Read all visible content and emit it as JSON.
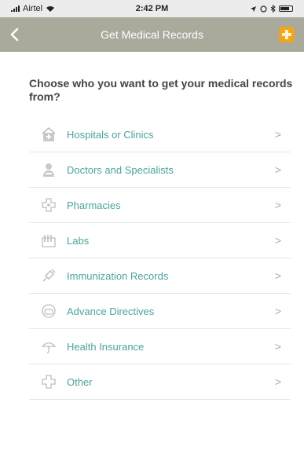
{
  "status_bar": {
    "carrier": "Airtel",
    "time": "2:42 PM"
  },
  "nav": {
    "title": "Get Medical Records",
    "back_icon": "chevron-left-icon",
    "badge_icon": "medical-cross-badge-icon"
  },
  "prompt": "Choose who you want to get your medical records from?",
  "records": [
    {
      "label": "Hospitals or Clinics",
      "icon": "hospital-icon"
    },
    {
      "label": "Doctors and Specialists",
      "icon": "doctor-icon"
    },
    {
      "label": "Pharmacies",
      "icon": "pharmacy-icon"
    },
    {
      "label": "Labs",
      "icon": "lab-icon"
    },
    {
      "label": "Immunization Records",
      "icon": "immunization-icon"
    },
    {
      "label": "Advance Directives",
      "icon": "advance-directives-icon"
    },
    {
      "label": "Health Insurance",
      "icon": "umbrella-icon"
    },
    {
      "label": "Other",
      "icon": "plus-outline-icon"
    }
  ],
  "chevron": ">",
  "colors": {
    "nav_bg": "#a9a99c",
    "accent": "#4aa39d",
    "badge": "#f0a51c"
  }
}
